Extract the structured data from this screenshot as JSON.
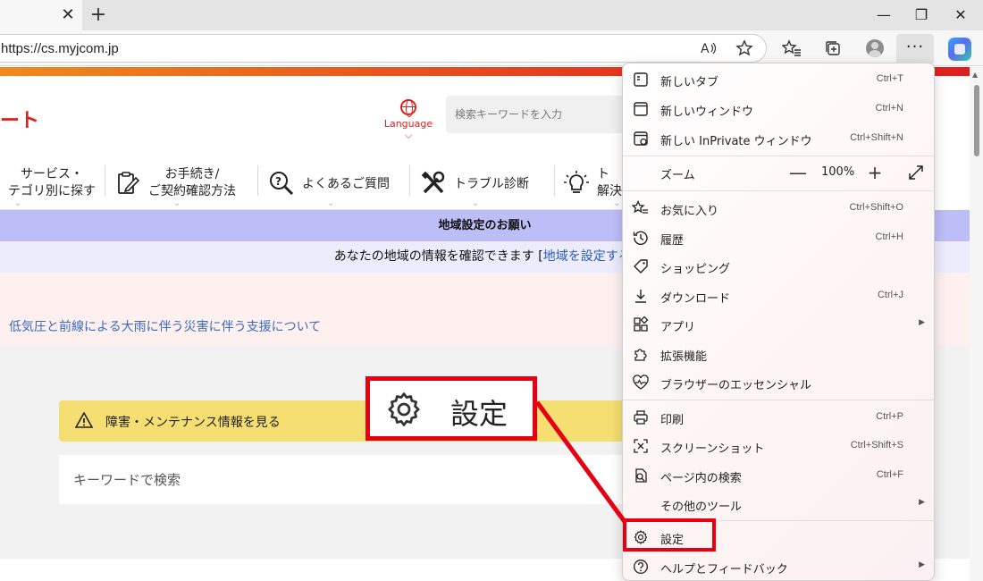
{
  "browser": {
    "tab_close_glyph": "✕",
    "newtab_glyph": "+",
    "url": "https://cs.myjcom.jp",
    "more_glyph": "···",
    "window_controls": {
      "minimize": "—",
      "restore": "❐",
      "close": "✕"
    }
  },
  "site": {
    "brand_tail": "ート",
    "language": "Language ⌵",
    "search_placeholder": "検索キーワードを入力",
    "nav": [
      {
        "line1": "サービス・",
        "line2": "テゴリ別に探す"
      },
      {
        "line1": "お手続き/",
        "line2": "ご契約確認方法"
      },
      {
        "line1": "よくあるご質問"
      },
      {
        "line1": "トラブル診断"
      },
      {
        "line1": "ト",
        "line2": "解決"
      }
    ],
    "caret": "⌄",
    "region_title": "地域設定のお願い",
    "region_text": "あなたの地域の情報を確認できます [",
    "region_link": "地域を設定する",
    "region_close": "]",
    "notice_link": "低気圧と前線による大雨に伴う災害に伴う支援について",
    "maintenance": "障害・メンテナンス情報を見る",
    "keyword_placeholder": "キーワードで検索"
  },
  "menu": {
    "items": [
      {
        "label": "新しいタブ",
        "shortcut": "Ctrl+T",
        "icon": "new-tab-icon"
      },
      {
        "label": "新しいウィンドウ",
        "shortcut": "Ctrl+N",
        "icon": "new-window-icon"
      },
      {
        "label": "新しい InPrivate ウィンドウ",
        "shortcut": "Ctrl+Shift+N",
        "icon": "inprivate-icon"
      },
      {
        "label": "お気に入り",
        "shortcut": "Ctrl+Shift+O",
        "icon": "favorites-icon"
      },
      {
        "label": "履歴",
        "shortcut": "Ctrl+H",
        "icon": "history-icon"
      },
      {
        "label": "ショッピング",
        "shortcut": "",
        "icon": "shopping-tag-icon"
      },
      {
        "label": "ダウンロード",
        "shortcut": "Ctrl+J",
        "icon": "download-icon"
      },
      {
        "label": "アプリ",
        "shortcut": "",
        "icon": "apps-icon"
      },
      {
        "label": "拡張機能",
        "shortcut": "",
        "icon": "extensions-icon"
      },
      {
        "label": "ブラウザーのエッセンシャル",
        "shortcut": "",
        "icon": "browser-essentials-icon"
      },
      {
        "label": "印刷",
        "shortcut": "Ctrl+P",
        "icon": "print-icon"
      },
      {
        "label": "スクリーンショット",
        "shortcut": "Ctrl+Shift+S",
        "icon": "screenshot-icon"
      },
      {
        "label": "ページ内の検索",
        "shortcut": "Ctrl+F",
        "icon": "find-icon"
      },
      {
        "label": "その他のツール",
        "shortcut": "",
        "icon": "more-tools-icon"
      },
      {
        "label": "設定",
        "shortcut": "",
        "icon": "settings-gear-icon"
      },
      {
        "label": "ヘルプとフィードバック",
        "shortcut": "",
        "icon": "help-icon"
      }
    ],
    "submenu_arrow": "▶",
    "zoom_label": "ズーム",
    "zoom_minus": "—",
    "zoom_value": "100%",
    "zoom_plus": "+"
  },
  "callout": {
    "label": "設定"
  },
  "colors": {
    "accent_red": "#e60012",
    "brand_red": "#e0201e",
    "menu_border": "#d0d0d0"
  }
}
